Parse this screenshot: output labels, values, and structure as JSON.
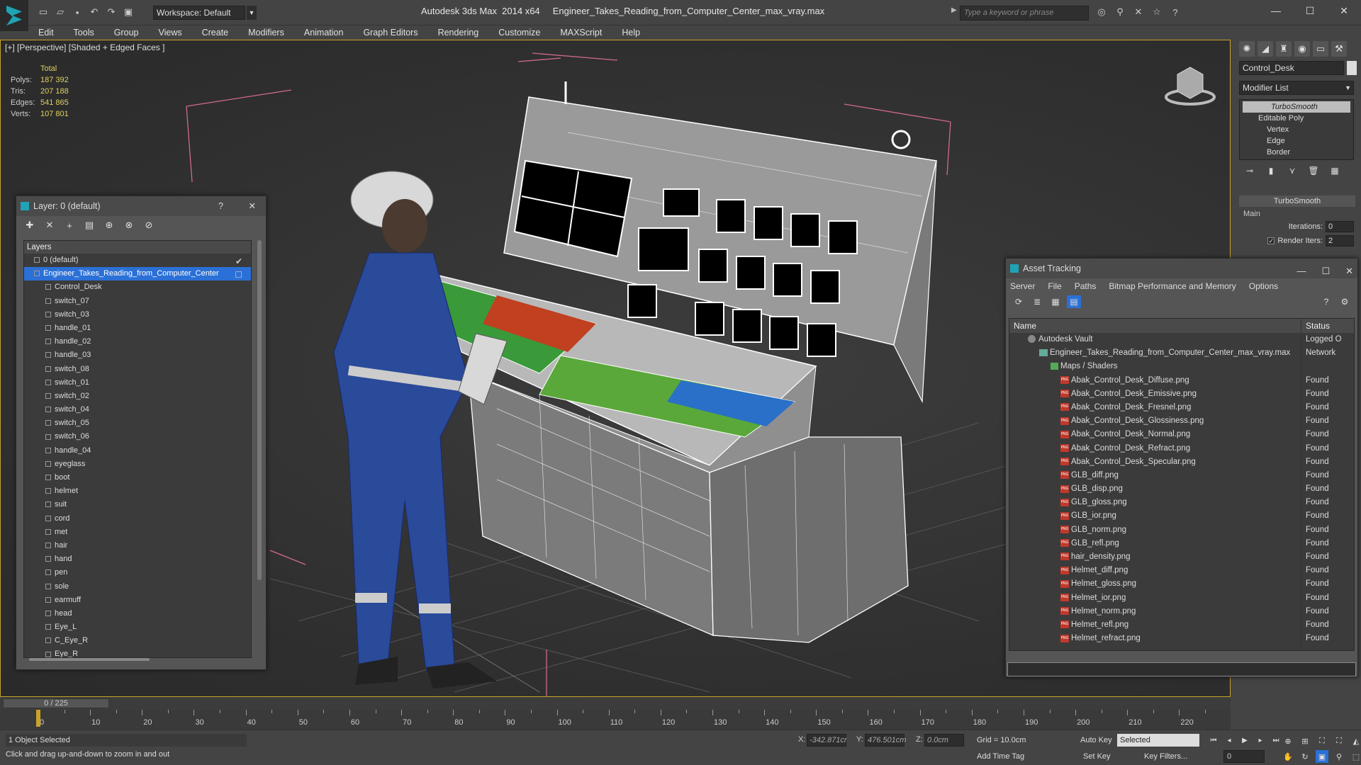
{
  "app": {
    "title": "Autodesk 3ds Max  2014 x64     Engineer_Takes_Reading_from_Computer_Center_max_vray.max",
    "workspace": "Workspace: Default",
    "search_placeholder": "Type a keyword or phrase"
  },
  "menu": [
    "Edit",
    "Tools",
    "Group",
    "Views",
    "Create",
    "Modifiers",
    "Animation",
    "Graph Editors",
    "Rendering",
    "Customize",
    "MAXScript",
    "Help"
  ],
  "viewport": {
    "label": "[+] [Perspective] [Shaded + Edged Faces ]",
    "stats_header": "Total",
    "stats": [
      {
        "key": "Polys:",
        "value": "187 392"
      },
      {
        "key": "Tris:",
        "value": "207 188"
      },
      {
        "key": "Edges:",
        "value": "541 865"
      },
      {
        "key": "Verts:",
        "value": "107 801"
      }
    ]
  },
  "command_panel": {
    "object_name": "Control_Desk",
    "modifier_list": "Modifier List",
    "stack": [
      "TurboSmooth",
      "Editable Poly",
      "Vertex",
      "Edge",
      "Border"
    ],
    "rollout": "TurboSmooth",
    "main_label": "Main",
    "iterations_label": "Iterations:",
    "iterations_value": "0",
    "render_iters_label": "Render Iters:",
    "render_iters_value": "2"
  },
  "layer_panel": {
    "title": "Layer: 0 (default)",
    "help": "?",
    "header": "Layers",
    "rows": [
      "0 (default)",
      "Engineer_Takes_Reading_from_Computer_Center",
      "Control_Desk",
      "switch_07",
      "switch_03",
      "handle_01",
      "handle_02",
      "handle_03",
      "switch_08",
      "switch_01",
      "switch_02",
      "switch_04",
      "switch_05",
      "switch_06",
      "handle_04",
      "eyeglass",
      "boot",
      "helmet",
      "suit",
      "cord",
      "met",
      "hair",
      "hand",
      "pen",
      "sole",
      "earmuff",
      "head",
      "Eye_L",
      "C_Eye_R",
      "Eye_R"
    ]
  },
  "asset_panel": {
    "title": "Asset Tracking",
    "menu": [
      "Server",
      "File",
      "Paths",
      "Bitmap Performance and Memory",
      "Options"
    ],
    "col_name": "Name",
    "col_status": "Status",
    "rows": [
      {
        "name": "Autodesk Vault",
        "status": "Logged O",
        "kind": "vault"
      },
      {
        "name": "Engineer_Takes_Reading_from_Computer_Center_max_vray.max",
        "status": "Network",
        "kind": "max"
      },
      {
        "name": "Maps / Shaders",
        "status": "",
        "kind": "map"
      },
      {
        "name": "Abak_Control_Desk_Diffuse.png",
        "status": "Found",
        "kind": "png"
      },
      {
        "name": "Abak_Control_Desk_Emissive.png",
        "status": "Found",
        "kind": "png"
      },
      {
        "name": "Abak_Control_Desk_Fresnel.png",
        "status": "Found",
        "kind": "png"
      },
      {
        "name": "Abak_Control_Desk_Glossiness.png",
        "status": "Found",
        "kind": "png"
      },
      {
        "name": "Abak_Control_Desk_Normal.png",
        "status": "Found",
        "kind": "png"
      },
      {
        "name": "Abak_Control_Desk_Refract.png",
        "status": "Found",
        "kind": "png"
      },
      {
        "name": "Abak_Control_Desk_Specular.png",
        "status": "Found",
        "kind": "png"
      },
      {
        "name": "GLB_diff.png",
        "status": "Found",
        "kind": "png"
      },
      {
        "name": "GLB_disp.png",
        "status": "Found",
        "kind": "png"
      },
      {
        "name": "GLB_gloss.png",
        "status": "Found",
        "kind": "png"
      },
      {
        "name": "GLB_ior.png",
        "status": "Found",
        "kind": "png"
      },
      {
        "name": "GLB_norm.png",
        "status": "Found",
        "kind": "png"
      },
      {
        "name": "GLB_refl.png",
        "status": "Found",
        "kind": "png"
      },
      {
        "name": "hair_density.png",
        "status": "Found",
        "kind": "png"
      },
      {
        "name": "Helmet_diff.png",
        "status": "Found",
        "kind": "png"
      },
      {
        "name": "Helmet_gloss.png",
        "status": "Found",
        "kind": "png"
      },
      {
        "name": "Helmet_ior.png",
        "status": "Found",
        "kind": "png"
      },
      {
        "name": "Helmet_norm.png",
        "status": "Found",
        "kind": "png"
      },
      {
        "name": "Helmet_refl.png",
        "status": "Found",
        "kind": "png"
      },
      {
        "name": "Helmet_refract.png",
        "status": "Found",
        "kind": "png"
      }
    ]
  },
  "timeline": {
    "slider": "0 / 225",
    "ticks": [
      "0",
      "10",
      "20",
      "30",
      "40",
      "50",
      "60",
      "70",
      "80",
      "90",
      "100",
      "110",
      "120",
      "130",
      "140",
      "150",
      "160",
      "170",
      "180",
      "190",
      "200",
      "210",
      "220"
    ]
  },
  "status": {
    "selection": "1 Object Selected",
    "prompt": "Click and drag up-and-down to zoom in and out",
    "x_label": "X:",
    "x_value": "-342.871cr",
    "y_label": "Y:",
    "y_value": "476.501cm",
    "z_label": "Z:",
    "z_value": "0.0cm",
    "grid": "Grid = 10.0cm",
    "add_time_tag": "Add Time Tag",
    "auto_key": "Auto Key",
    "set_key": "Set Key",
    "selected": "Selected",
    "key_filters": "Key Filters...",
    "frame": "0"
  },
  "colors": {
    "accent": "#1fa3b5",
    "selection": "#2b70d6",
    "viewport_border": "#c9a227",
    "stats": "#e0d060"
  }
}
